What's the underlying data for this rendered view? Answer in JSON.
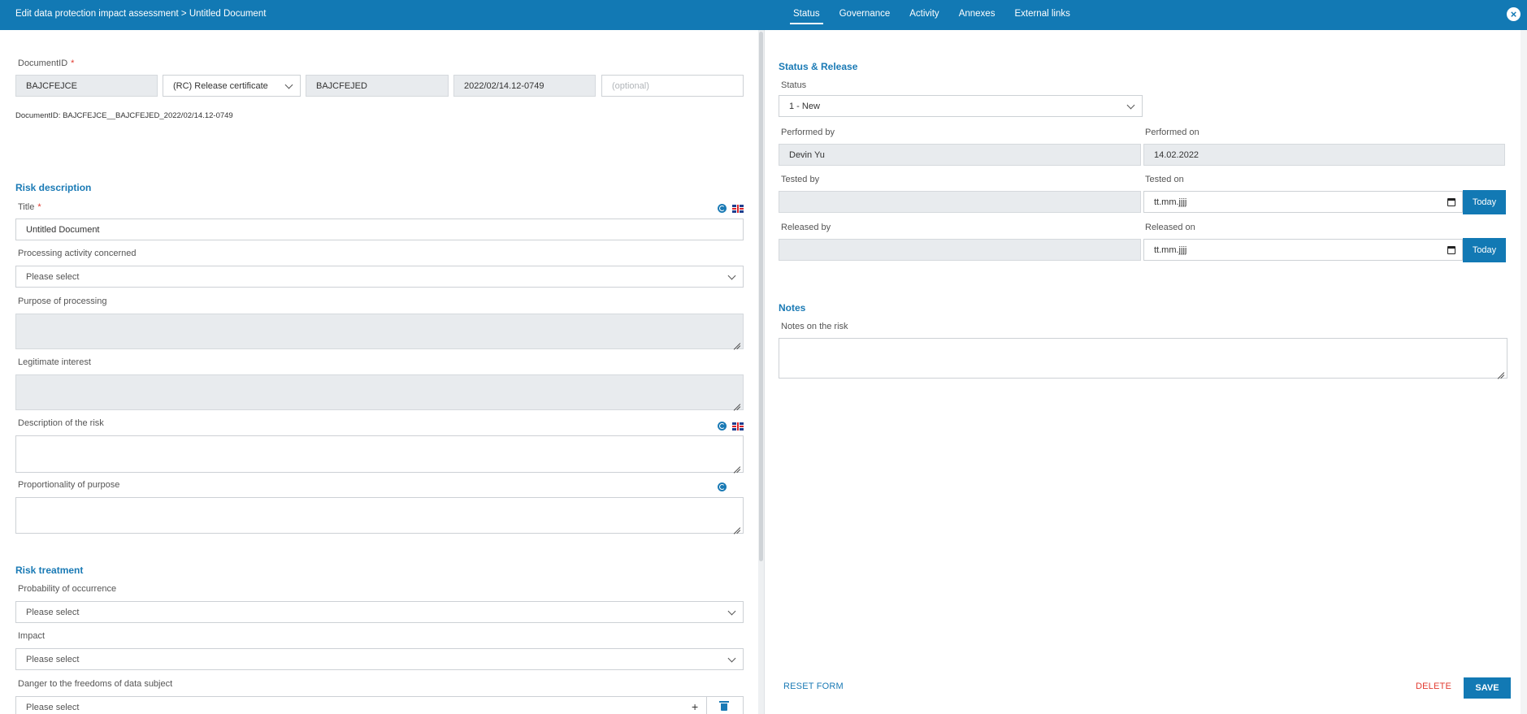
{
  "header": {
    "breadcrumb": "Edit data protection impact assessment > Untitled Document",
    "tabs": [
      {
        "label": "Status",
        "active": true
      },
      {
        "label": "Governance",
        "active": false
      },
      {
        "label": "Activity",
        "active": false
      },
      {
        "label": "Annexes",
        "active": false
      },
      {
        "label": "External links",
        "active": false
      }
    ],
    "close_icon": "close-icon"
  },
  "document_id": {
    "label": "DocumentID",
    "required_mark": "*",
    "part1": "BAJCFEJCE",
    "type_select": "(RC) Release certificate",
    "part3": "BAJCFEJED",
    "part4": "2022/02/14.12-0749",
    "optional_placeholder": "(optional)",
    "summary": "DocumentID: BAJCFEJCE__BAJCFEJED_2022/02/14.12-0749"
  },
  "risk_description": {
    "heading": "Risk description",
    "title_label": "Title",
    "title_required": "*",
    "title_value": "Untitled Document",
    "processing_activity_label": "Processing activity concerned",
    "processing_activity_value": "Please select",
    "purpose_label": "Purpose of processing",
    "legitimate_interest_label": "Legitimate interest",
    "description_label": "Description of the risk",
    "proportionality_label": "Proportionality of purpose"
  },
  "risk_treatment": {
    "heading": "Risk treatment",
    "probability_label": "Probability of occurrence",
    "probability_value": "Please select",
    "impact_label": "Impact",
    "impact_value": "Please select",
    "danger_label": "Danger to the freedoms of data subject",
    "danger_value": "Please select",
    "plus_glyph": "+"
  },
  "status_release": {
    "heading": "Status & Release",
    "status_label": "Status",
    "status_value": "1 - New",
    "performed_by_label": "Performed by",
    "performed_by_value": "Devin Yu",
    "performed_on_label": "Performed on",
    "performed_on_value": "14.02.2022",
    "tested_by_label": "Tested by",
    "tested_on_label": "Tested on",
    "tested_on_placeholder": "tt.mm.jjjj",
    "released_by_label": "Released by",
    "released_on_label": "Released on",
    "released_on_placeholder": "tt.mm.jjjj",
    "today_label": "Today"
  },
  "notes": {
    "heading": "Notes",
    "notes_label": "Notes on the risk"
  },
  "footer": {
    "reset_label": "RESET FORM",
    "delete_label": "DELETE",
    "save_label": "SAVE"
  },
  "colors": {
    "primary": "#1279b4",
    "section_heading": "#1a7ab5",
    "delete": "#e2392f",
    "readonly_field": "#e8ebee"
  }
}
